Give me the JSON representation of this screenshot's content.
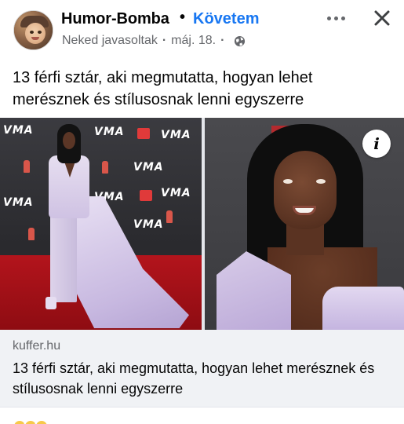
{
  "post": {
    "author": "Humor-Bomba",
    "separator": "•",
    "follow_label": "Követem",
    "meta_label": "Neked javasoltak",
    "meta_separator": "·",
    "date": "máj. 18.",
    "audience_icon": "globe-icon",
    "caption": "13 férfi sztár, aki megmutatta, hogyan lehet merésznek és stílusosnak lenni egyszerre"
  },
  "media": {
    "left_photo_signage": [
      "VMA",
      "VMA",
      "VMA",
      "VMA",
      "VMA",
      "VMA",
      "VMA",
      "VMA"
    ],
    "info_badge": "i"
  },
  "link_preview": {
    "domain": "kuffer.hu",
    "title": "13 férfi sztár, aki megmutatta, hogyan lehet merésznek és stílusosnak lenni egyszerre"
  },
  "colors": {
    "link_blue": "#1877f2",
    "secondary_text": "#65676b",
    "preview_bg": "#f0f2f5"
  }
}
